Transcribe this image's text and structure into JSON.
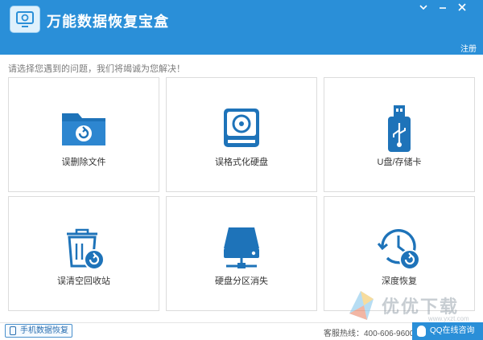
{
  "app": {
    "title": "万能数据恢复宝盒",
    "register_label": "注册",
    "window_controls": [
      "chevron-down-icon",
      "minimize-icon",
      "close-icon"
    ]
  },
  "subtitle": "请选择您遇到的问题，我们将竭诚为您解决！",
  "cards": [
    {
      "label": "误删除文件",
      "icon": "folder-restore-icon"
    },
    {
      "label": "误格式化硬盘",
      "icon": "hard-drive-format-icon"
    },
    {
      "label": "U盘/存储卡",
      "icon": "usb-drive-icon"
    },
    {
      "label": "误清空回收站",
      "icon": "recycle-bin-icon"
    },
    {
      "label": "硬盘分区消失",
      "icon": "disk-partition-icon"
    },
    {
      "label": "深度恢复",
      "icon": "clock-restore-icon"
    }
  ],
  "footer": {
    "phone_recovery_label": "手机数据恢复",
    "hotline": "客服热线：400-606-9600",
    "qq_label": "QQ在线咨询"
  },
  "watermark": {
    "text": "优优下载",
    "url": "www.yxzt.com"
  },
  "colors": {
    "accent": "#2a8fd8",
    "icon_blue": "#1e73b9"
  }
}
